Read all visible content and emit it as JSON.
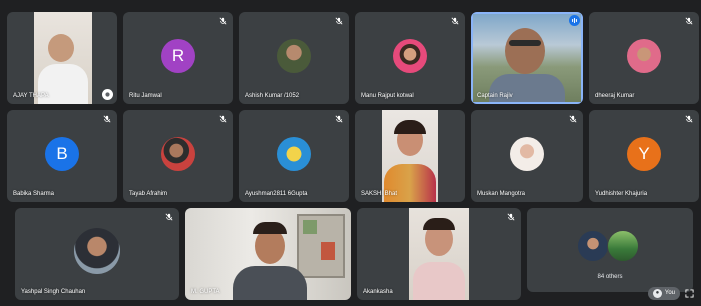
{
  "participants": {
    "ajay": {
      "name": "AJAY THAPA"
    },
    "ritu": {
      "name": "Ritu Jamwal",
      "initial": "R"
    },
    "ashish": {
      "name": "Ashish Kumar /1052"
    },
    "manu": {
      "name": "Manu Rajput kotwal"
    },
    "rajiv": {
      "name": "Captain Rajiv"
    },
    "dheeraj": {
      "name": "dheeraj Kumar"
    },
    "babika": {
      "name": "Babika Sharma",
      "initial": "B"
    },
    "tayab": {
      "name": "Tayab Afrahim"
    },
    "ayushman": {
      "name": "Ayushman2811 6Gupta"
    },
    "sakshi": {
      "name": "SAKSHI Bhat"
    },
    "muskan": {
      "name": "Muskan Mangotra"
    },
    "yudhishter": {
      "name": "Yudhishter Khajuria",
      "initial": "Y"
    },
    "yashpal": {
      "name": "Yashpal Singh Chauhan"
    },
    "gupta": {
      "name": "M. GUPTA"
    },
    "akankasha": {
      "name": "Akankasha"
    }
  },
  "others": {
    "label": "84 others"
  },
  "self_chip": {
    "label": "You"
  },
  "colors": {
    "tile": "#3c4043",
    "background": "#1f2022",
    "ritu": "#a142c4",
    "babika": "#1a73e8",
    "yudhishter": "#e8711a",
    "active_outline": "#8ab4f8"
  },
  "icons": {
    "mute": "mic-off-icon",
    "speaking": "audio-wave-icon",
    "pin": "pin-icon",
    "expand": "expand-icon"
  }
}
